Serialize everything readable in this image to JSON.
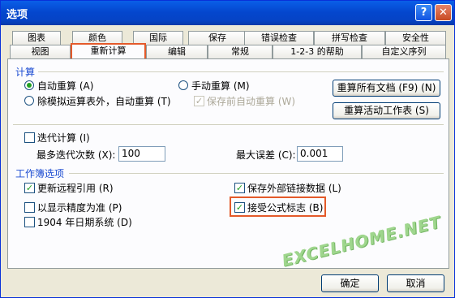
{
  "window": {
    "title": "选项",
    "help_label": "?",
    "close_label": "✕"
  },
  "tabs_row1": [
    {
      "label": "图表"
    },
    {
      "label": "颜色"
    },
    {
      "label": "国际"
    },
    {
      "label": "保存"
    },
    {
      "label": "错误检查"
    },
    {
      "label": "拼写检查"
    },
    {
      "label": "安全性"
    }
  ],
  "tabs_row2": [
    {
      "label": "视图"
    },
    {
      "label": "重新计算",
      "active": true
    },
    {
      "label": "编辑"
    },
    {
      "label": "常规"
    },
    {
      "label": "1-2-3 的帮助"
    },
    {
      "label": "自定义序列"
    }
  ],
  "calc": {
    "section_label": "计算",
    "auto_label": "自动重算 (A)",
    "auto_selected": true,
    "except_tables_label": "除模拟运算表外，自动重算 (T)",
    "manual_label": "手动重算 (M)",
    "save_before_label": "保存前自动重算 (W)",
    "save_before_checked": true,
    "calc_all_btn": "重算所有文档 (F9) (N)",
    "calc_sheet_btn": "重算活动工作表 (S)"
  },
  "iteration": {
    "iter_label": "迭代计算 (I)",
    "iter_checked": false,
    "max_iter_label": "最多迭代次数 (X):",
    "max_iter_value": "100",
    "max_change_label": "最大误差 (C):",
    "max_change_value": "0.001"
  },
  "workbook": {
    "section_label": "工作簿选项",
    "update_remote_label": "更新远程引用 (R)",
    "update_remote_checked": true,
    "precision_label": "以显示精度为准 (P)",
    "precision_checked": false,
    "date1904_label": "1904 年日期系统 (D)",
    "date1904_checked": false,
    "save_links_label": "保存外部链接数据 (L)",
    "save_links_checked": true,
    "accept_labels_label": "接受公式标志 (B)",
    "accept_labels_checked": true
  },
  "footer": {
    "ok_label": "确定",
    "cancel_label": "取消"
  },
  "watermark": "EXCELHOME.NET",
  "colors": {
    "title_bar": "#0A5FE8",
    "highlight": "#E45A2A",
    "section_text": "#1B4BD1",
    "watermark": "#8FD07A"
  }
}
